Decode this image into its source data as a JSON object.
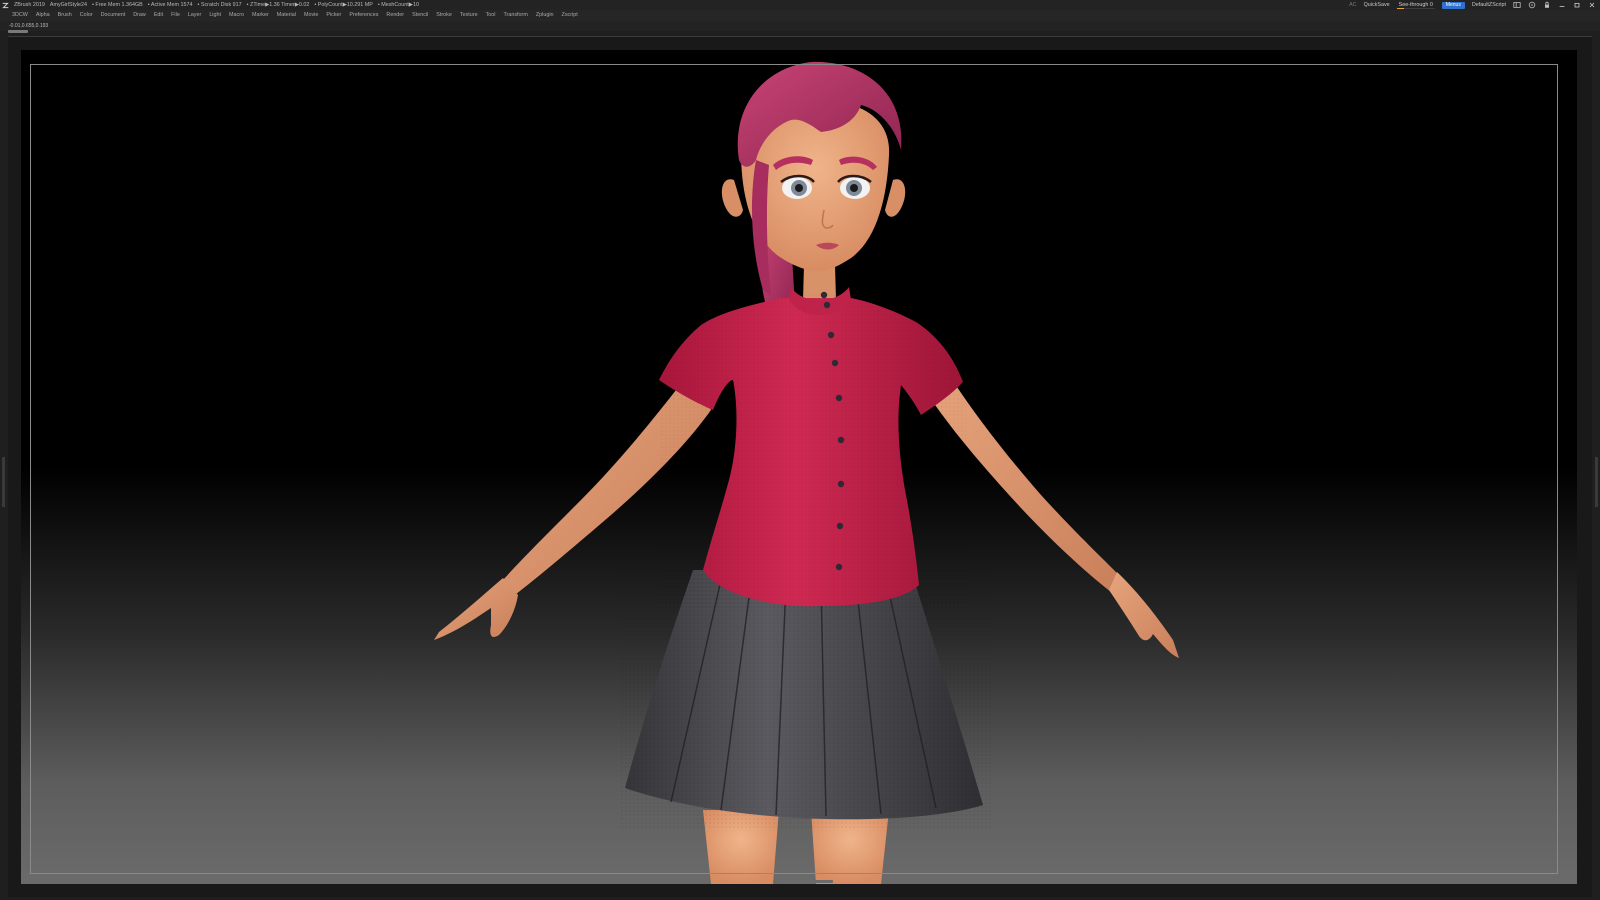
{
  "titlebar": {
    "app": "ZBrush 2019",
    "document": "AmyGirlStyle24",
    "free_mem": "• Free Mem 1.364GB",
    "active_mem": "• Active Mem 1574",
    "scratch_disk": "• Scratch Disk 917",
    "ztime": "• ZTime▶1.36 Timer▶0.02",
    "polycount": "• PolyCount▶10.291 MP",
    "meshcount": "• MeshCount▶10",
    "ac": "AC",
    "quicksave": "QuickSave",
    "see_through_label": "See-through",
    "see_through_value": "0",
    "see_through_level": 0,
    "menus": "Menus",
    "script": "DefaultZScript"
  },
  "menu": {
    "items": [
      "3DCW",
      "Alpha",
      "Brush",
      "Color",
      "Document",
      "Draw",
      "Edit",
      "File",
      "Layer",
      "Light",
      "Macro",
      "Marker",
      "Material",
      "Movie",
      "Picker",
      "Preferences",
      "Render",
      "Stencil",
      "Stroke",
      "Texture",
      "Tool",
      "Transform",
      "Zplugin",
      "Zscript"
    ]
  },
  "status": {
    "coordinates": "-0.01,0.655,0.193"
  },
  "colors": {
    "menus_button": "#2f6fd0",
    "see_through_slider": "#e8a33a",
    "shirt": "#c8224c",
    "hair": "#b23466",
    "skin": "#e7a67a",
    "skirt": "#4a4a50"
  },
  "icons": [
    "zbrush-logo-icon",
    "layout-icon",
    "palette-icon",
    "lock-icon",
    "minimize-icon",
    "restore-icon",
    "close-icon"
  ]
}
